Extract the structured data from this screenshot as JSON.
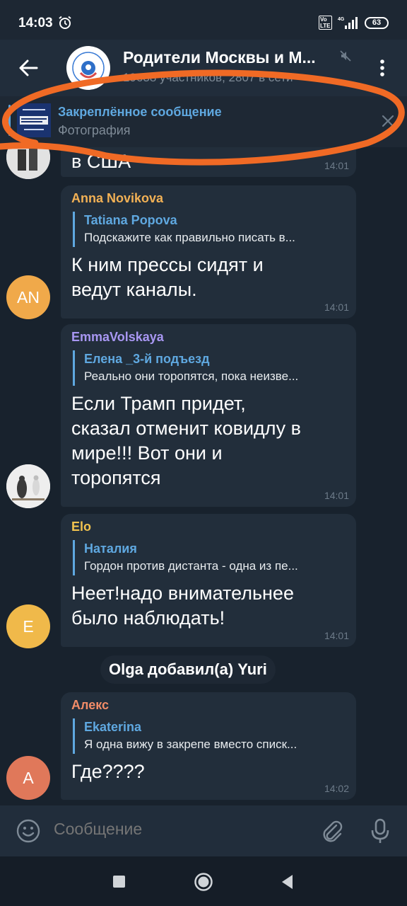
{
  "status_bar": {
    "time": "14:03",
    "network": "4G",
    "volte": "Vo\nLTE",
    "battery": "63"
  },
  "header": {
    "title": "Родители Москвы и М...",
    "subtitle": "19638 участников, 2807 в сети"
  },
  "pinned": {
    "title": "Закреплённое сообщение",
    "subtitle": "Фотография"
  },
  "partial_message": {
    "text": "в США",
    "time": "14:01"
  },
  "messages": [
    {
      "sender": "Anna Novikova",
      "sender_color": "#f2b155",
      "reply_name": "Tatiana Popova",
      "reply_text": "Подскажите как правильно писать в...",
      "text": "К ним прессы сидят и ведут каналы.",
      "time": "14:01",
      "avatar_initials": "AN",
      "avatar_color": "#f0a94a"
    },
    {
      "sender": "EmmaVolskaya",
      "sender_color": "#a897f2",
      "reply_name": "Елена _3-й подъезд",
      "reply_text": "Реально они торопятся, пока неизве...",
      "text": "Если Трамп придет, сказал отменит ковидлу в мире!!! Вот они и торопятся",
      "time": "14:01",
      "avatar_initials": "",
      "avatar_color": "#e6e6e6"
    },
    {
      "sender": "Elo",
      "sender_color": "#f2c34f",
      "reply_name": "Наталия",
      "reply_text": "Гордон против дистанта - одна из пе...",
      "text": "Неет!надо внимательнее было наблюдать!",
      "time": "14:01",
      "avatar_initials": "E",
      "avatar_color": "#f0b94a"
    },
    {
      "sender": "Алекс",
      "sender_color": "#f28c68",
      "reply_name": "Ekaterina",
      "reply_text": "Я одна вижу в закрепе вместо списк...",
      "text": "Где????",
      "time": "14:02",
      "avatar_initials": "А",
      "avatar_color": "#e0785a"
    }
  ],
  "service_message": "Olga добавил(а) Yuri",
  "input": {
    "placeholder": "Сообщение"
  },
  "colors": {
    "background": "#18222d",
    "bubble": "#222e3b",
    "accent": "#5fa8e0",
    "annotation": "#f06a25"
  }
}
